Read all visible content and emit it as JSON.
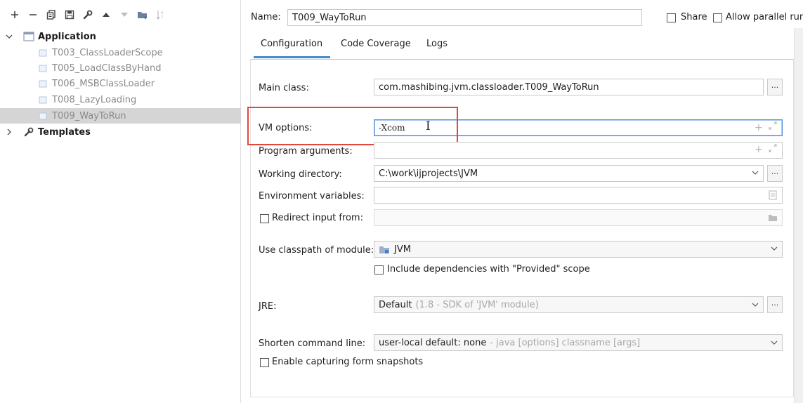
{
  "toolbar": {
    "icons": [
      "plus-icon",
      "minus-icon",
      "copy-icon",
      "save-icon",
      "wrench-icon",
      "arrow-up-icon",
      "arrow-down-icon",
      "folder-add-icon",
      "sort-icon"
    ]
  },
  "tree": {
    "application_label": "Application",
    "children": [
      "T003_ClassLoaderScope",
      "T005_LoadClassByHand",
      "T006_MSBClassLoader",
      "T008_LazyLoading",
      "T009_WayToRun"
    ],
    "templates_label": "Templates"
  },
  "header": {
    "name_label": "Name:",
    "name_value": "T009_WayToRun",
    "share_label": "Share",
    "allow_parallel_label": "Allow parallel run"
  },
  "tabs": [
    "Configuration",
    "Code Coverage",
    "Logs"
  ],
  "form": {
    "main_class_label": "Main class:",
    "main_class_value": "com.mashibing.jvm.classloader.T009_WayToRun",
    "vm_options_label": "VM options:",
    "vm_options_value": "-Xcom",
    "program_arguments_label": "Program arguments:",
    "program_arguments_value": "",
    "working_directory_label": "Working directory:",
    "working_directory_value": "C:\\work\\ijprojects\\JVM",
    "env_vars_label": "Environment variables:",
    "env_vars_value": "",
    "redirect_input_label": "Redirect input from:",
    "classpath_label": "Use classpath of module:",
    "classpath_value": "JVM",
    "include_deps_label": "Include dependencies with \"Provided\" scope",
    "jre_label": "JRE:",
    "jre_value": "Default",
    "jre_hint": "(1.8 - SDK of 'JVM' module)",
    "shorten_label": "Shorten command line:",
    "shorten_value": "user-local default: none",
    "shorten_hint": "- java [options] classname [args]",
    "snapshots_label": "Enable capturing form snapshots",
    "dots": "..."
  },
  "colors": {
    "accent": "#4a8ad4",
    "selection": "#d5d5d5",
    "highlight_box": "#e0483e"
  }
}
